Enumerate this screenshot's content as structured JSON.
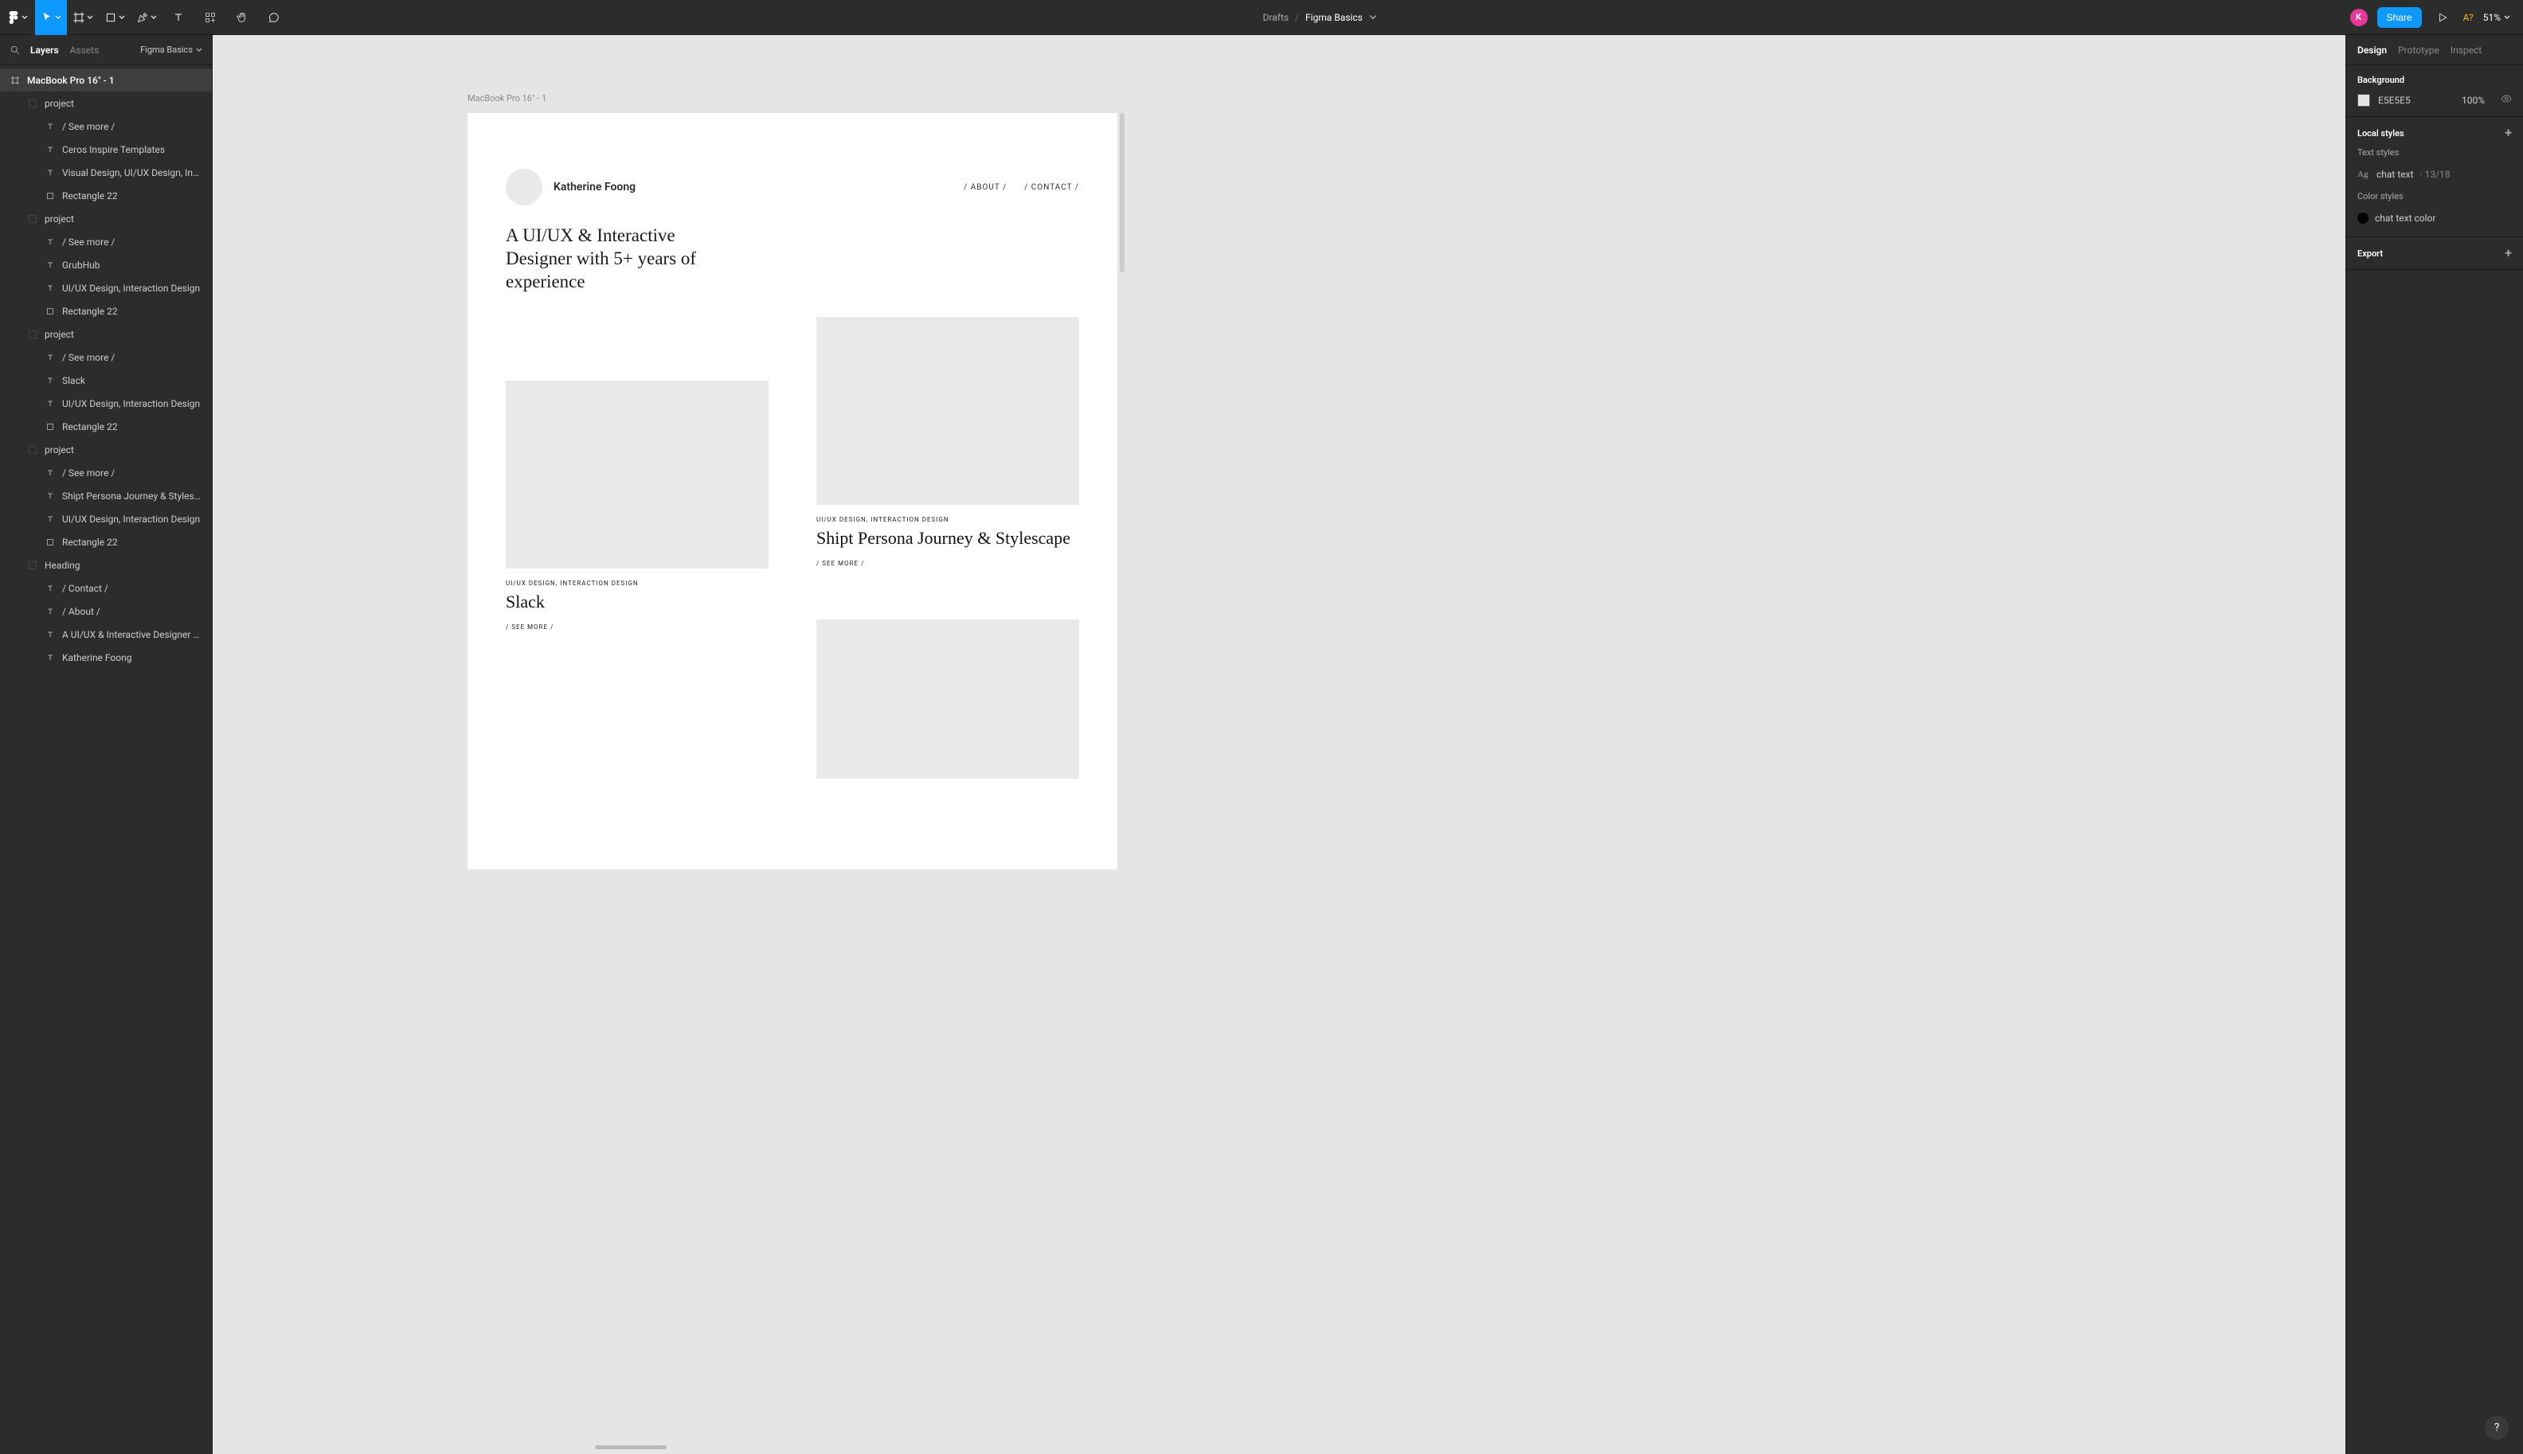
{
  "toolbar": {
    "breadcrumb_root": "Drafts",
    "breadcrumb_current": "Figma Basics",
    "avatar_initial": "K",
    "share_label": "Share",
    "a11y_label": "A?",
    "zoom_label": "51%"
  },
  "left_panel": {
    "tabs": {
      "layers": "Layers",
      "assets": "Assets"
    },
    "page_selector": "Figma Basics",
    "layers": [
      {
        "type": "frame",
        "indent": 0,
        "label": "MacBook Pro 16\" - 1",
        "selected": true
      },
      {
        "type": "group",
        "indent": 1,
        "label": "project"
      },
      {
        "type": "text",
        "indent": 2,
        "label": "/ See more /"
      },
      {
        "type": "text",
        "indent": 2,
        "label": "Ceros Inspire Templates"
      },
      {
        "type": "text",
        "indent": 2,
        "label": "Visual Design, UI/UX Design, Inter..."
      },
      {
        "type": "rect",
        "indent": 2,
        "label": "Rectangle 22"
      },
      {
        "type": "group",
        "indent": 1,
        "label": "project"
      },
      {
        "type": "text",
        "indent": 2,
        "label": "/ See more /"
      },
      {
        "type": "text",
        "indent": 2,
        "label": "GrubHub"
      },
      {
        "type": "text",
        "indent": 2,
        "label": "UI/UX Design, Interaction Design"
      },
      {
        "type": "rect",
        "indent": 2,
        "label": "Rectangle 22"
      },
      {
        "type": "group",
        "indent": 1,
        "label": "project"
      },
      {
        "type": "text",
        "indent": 2,
        "label": "/ See more /"
      },
      {
        "type": "text",
        "indent": 2,
        "label": "Slack"
      },
      {
        "type": "text",
        "indent": 2,
        "label": "UI/UX Design, Interaction Design"
      },
      {
        "type": "rect",
        "indent": 2,
        "label": "Rectangle 22"
      },
      {
        "type": "group",
        "indent": 1,
        "label": "project"
      },
      {
        "type": "text",
        "indent": 2,
        "label": "/ See more /"
      },
      {
        "type": "text",
        "indent": 2,
        "label": "Shipt Persona Journey & Stylescape"
      },
      {
        "type": "text",
        "indent": 2,
        "label": "UI/UX Design, Interaction Design"
      },
      {
        "type": "rect",
        "indent": 2,
        "label": "Rectangle 22"
      },
      {
        "type": "group",
        "indent": 1,
        "label": "Heading"
      },
      {
        "type": "text",
        "indent": 2,
        "label": "/ Contact /"
      },
      {
        "type": "text",
        "indent": 2,
        "label": "/ About /"
      },
      {
        "type": "text",
        "indent": 2,
        "label": "A UI/UX & Interactive Designer wit..."
      },
      {
        "type": "text",
        "indent": 2,
        "label": "Katherine Foong"
      }
    ]
  },
  "canvas": {
    "frame_label": "MacBook Pro 16\" - 1",
    "header_name": "Katherine Foong",
    "nav": {
      "about": "/ ABOUT /",
      "contact": "/ CONTACT /"
    },
    "headline": "A UI/UX & Interactive Designer with 5+ years of experience",
    "proj1": {
      "category": "UI/UX DESIGN, INTERACTION DESIGN",
      "title": "Shipt Persona Journey & Stylescape",
      "more": "/ SEE MORE /"
    },
    "proj2": {
      "category": "UI/UX DESIGN, INTERACTION DESIGN",
      "title": "Slack",
      "more": "/ SEE MORE /"
    }
  },
  "right_panel": {
    "tabs": {
      "design": "Design",
      "prototype": "Prototype",
      "inspect": "Inspect"
    },
    "background_label": "Background",
    "bg_hex": "E5E5E5",
    "bg_opacity": "100%",
    "local_styles_label": "Local styles",
    "text_styles_label": "Text styles",
    "text_style_name": "chat text",
    "text_style_meta": "· 13/18",
    "color_styles_label": "Color styles",
    "color_style_name": "chat text color",
    "export_label": "Export"
  }
}
